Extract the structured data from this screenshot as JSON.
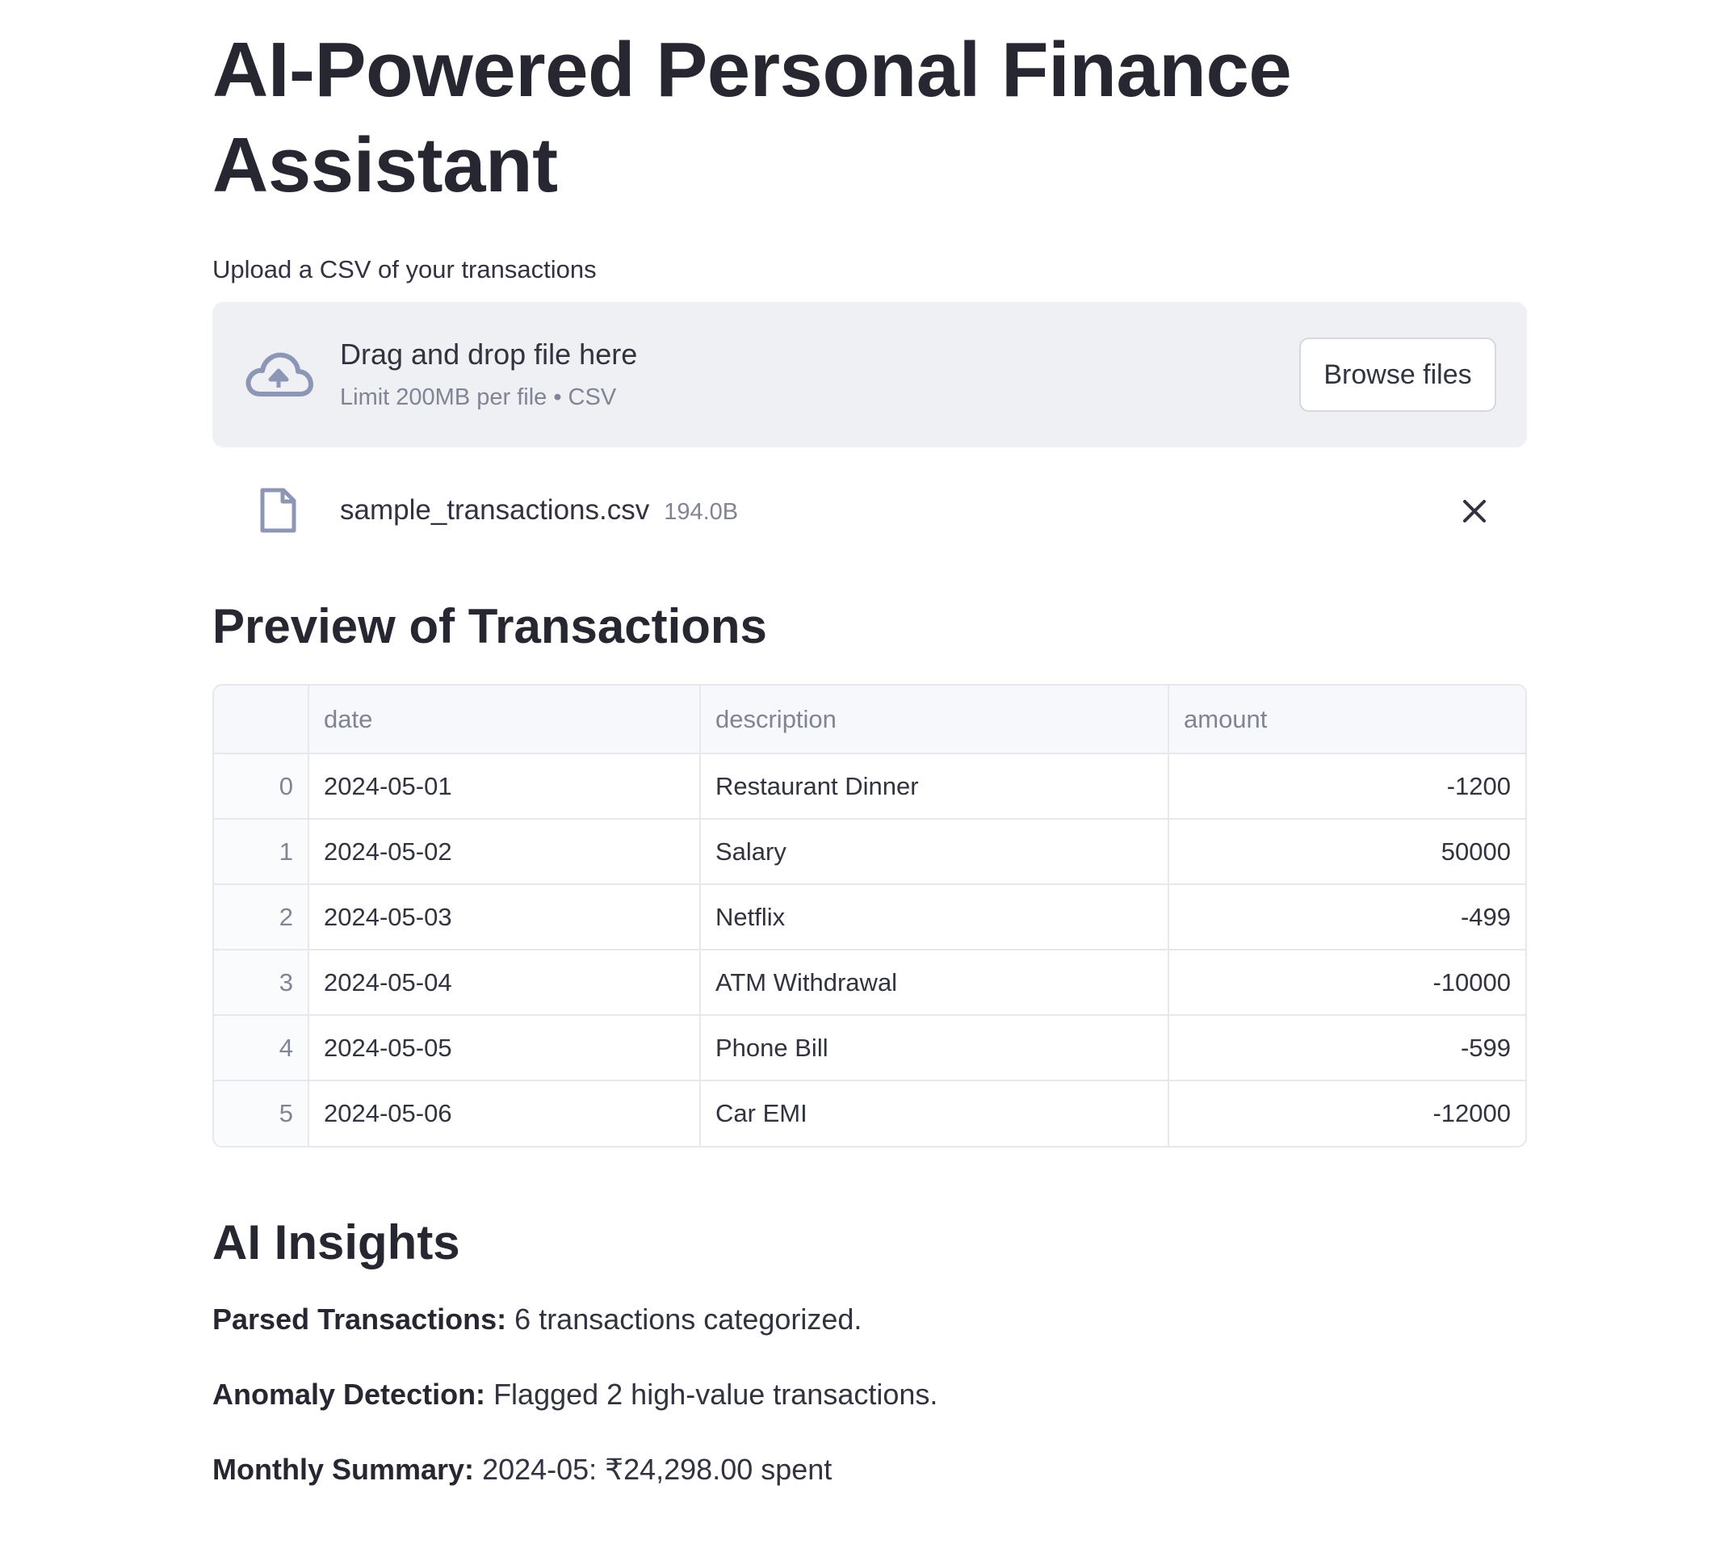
{
  "page": {
    "title": "AI-Powered Personal Finance Assistant"
  },
  "uploader": {
    "label": "Upload a CSV of your transactions",
    "drop_title": "Drag and drop file here",
    "drop_subtitle": "Limit 200MB per file • CSV",
    "browse_label": "Browse files",
    "icon": "cloud-upload-icon"
  },
  "uploaded_file": {
    "name": "sample_transactions.csv",
    "size": "194.0B",
    "icon": "file-icon",
    "remove_icon": "close-icon"
  },
  "preview": {
    "title": "Preview of Transactions",
    "columns": [
      "",
      "date",
      "description",
      "amount"
    ],
    "rows": [
      {
        "index": "0",
        "date": "2024-05-01",
        "description": "Restaurant Dinner",
        "amount": "-1200"
      },
      {
        "index": "1",
        "date": "2024-05-02",
        "description": "Salary",
        "amount": "50000"
      },
      {
        "index": "2",
        "date": "2024-05-03",
        "description": "Netflix",
        "amount": "-499"
      },
      {
        "index": "3",
        "date": "2024-05-04",
        "description": "ATM Withdrawal",
        "amount": "-10000"
      },
      {
        "index": "4",
        "date": "2024-05-05",
        "description": "Phone Bill",
        "amount": "-599"
      },
      {
        "index": "5",
        "date": "2024-05-06",
        "description": "Car EMI",
        "amount": "-12000"
      }
    ]
  },
  "insights": {
    "title": "AI Insights",
    "items": [
      {
        "label": "Parsed Transactions:",
        "text": "6 transactions categorized."
      },
      {
        "label": "Anomaly Detection:",
        "text": "Flagged 2 high-value transactions."
      },
      {
        "label": "Monthly Summary:",
        "text": "2024-05: ₹24,298.00 spent"
      }
    ]
  },
  "colors": {
    "text": "#31333f",
    "muted": "#808495",
    "dropzone_bg": "#eef0f4",
    "icon": "#8d97b5"
  }
}
